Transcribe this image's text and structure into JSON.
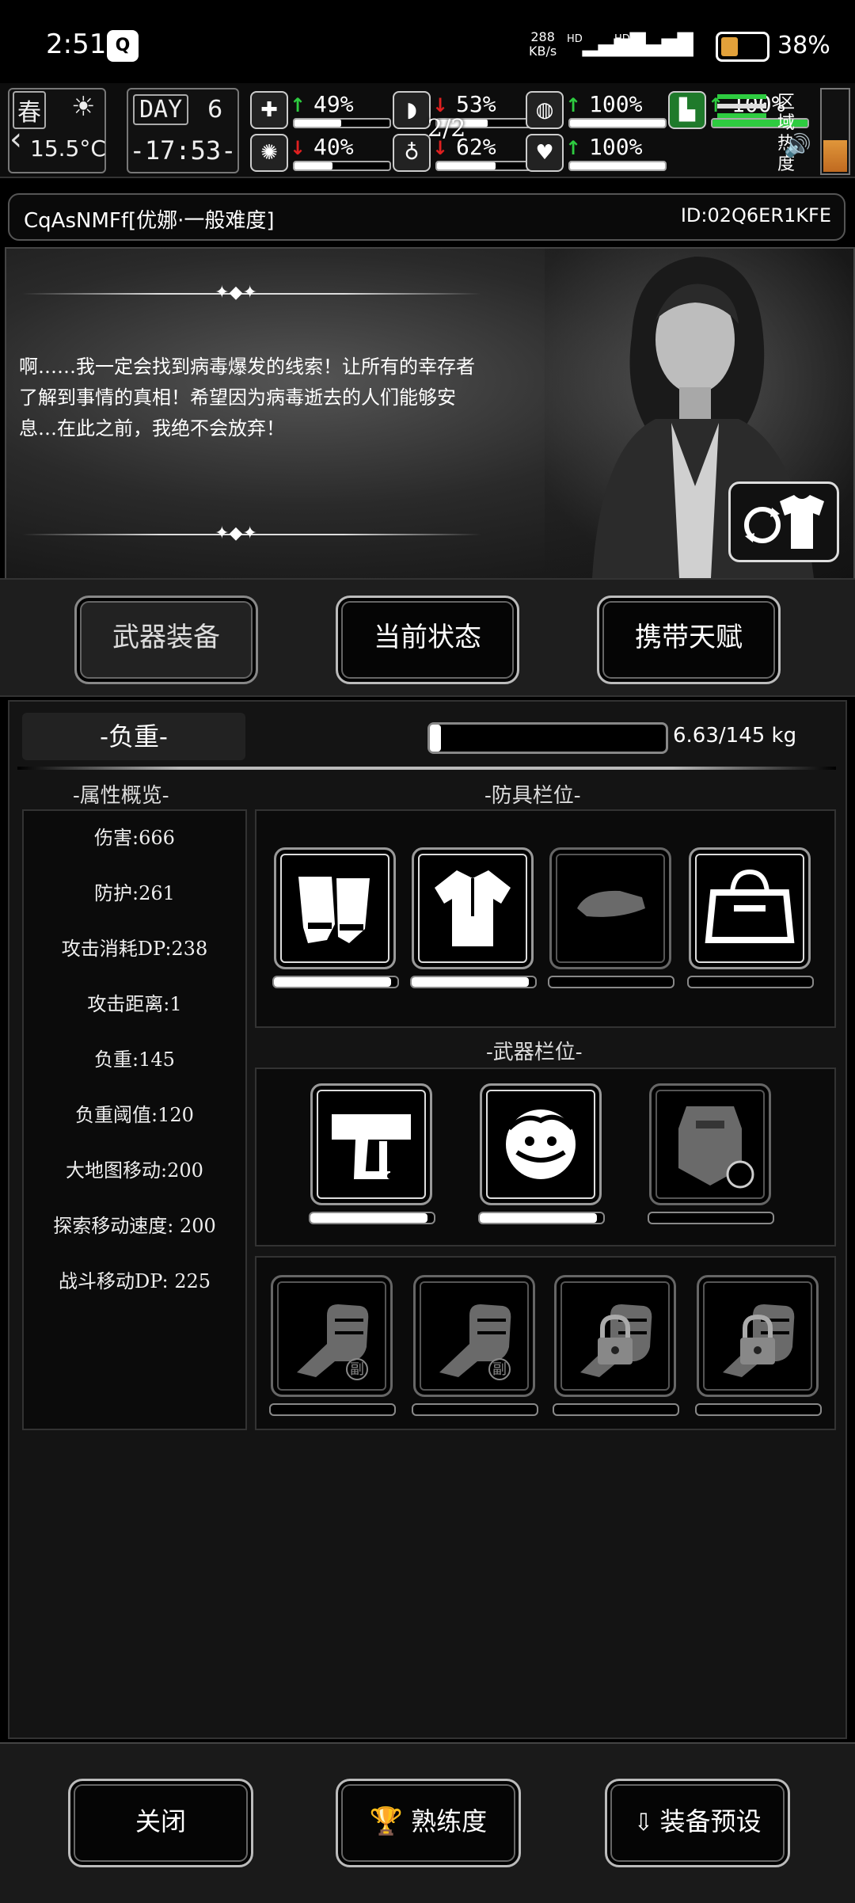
{
  "status_bar": {
    "time": "2:51",
    "app_icon": "qq-icon",
    "net_speed": "288",
    "net_unit": "KB/s",
    "hd1": "HD",
    "hd2": "HD",
    "battery_pct": "38",
    "battery_level": 0.38
  },
  "hud": {
    "season": "春",
    "temperature": "15.5°C",
    "day_label": "DAY",
    "day_num": "6",
    "clock": "-17:53-",
    "page": "2/2",
    "zone_label": "区域热度",
    "stats": [
      {
        "icon": "medkit-icon",
        "arrow": "↑",
        "trend": "up",
        "value": "49%",
        "level": 0.49
      },
      {
        "icon": "brain-icon",
        "arrow": "↓",
        "trend": "down",
        "value": "40%",
        "level": 0.4
      },
      {
        "icon": "stomach-icon",
        "arrow": "↓",
        "trend": "down",
        "value": "53%",
        "level": 0.53
      },
      {
        "icon": "water-icon",
        "arrow": "↓",
        "trend": "down",
        "value": "62%",
        "level": 0.62
      },
      {
        "icon": "lungs-icon",
        "arrow": "↑",
        "trend": "up",
        "value": "100%",
        "level": 1.0
      },
      {
        "icon": "heart-icon",
        "arrow": "↑",
        "trend": "up",
        "value": "100%",
        "level": 1.0
      },
      {
        "icon": "boot-icon",
        "arrow": "↑",
        "trend": "up",
        "value": "100%",
        "level": 1.0
      }
    ]
  },
  "title_bar": {
    "name": "CqAsNMFf[优娜·一般难度]",
    "id": "ID:02Q6ER1KFE"
  },
  "story": {
    "text": "啊……我一定会找到病毒爆发的线索！让所有的幸存者了解到事情的真相！希望因为病毒逝去的人们能够安息…在此之前，我绝不会放弃！"
  },
  "tabs": [
    {
      "label": "武器装备",
      "active": true
    },
    {
      "label": "当前状态",
      "active": false
    },
    {
      "label": "携带天赋",
      "active": false
    }
  ],
  "load": {
    "label": "-负重-",
    "value": "6.63/145 kg",
    "ratio": 0.046
  },
  "attributes": {
    "header": "-属性概览-",
    "items": [
      "伤害:666",
      "防护:261",
      "攻击消耗DP:238",
      "攻击距离:1",
      "负重:145",
      "负重阈值:120",
      "大地图移动:200",
      "探索移动速度: 200",
      "战斗移动DP: 225"
    ]
  },
  "armor": {
    "header": "-防具栏位-",
    "slots": [
      {
        "name": "gloves-icon",
        "durability": 0.95
      },
      {
        "name": "shirt-icon",
        "durability": 0.95
      },
      {
        "name": "cap-icon",
        "durability": 0
      },
      {
        "name": "bag-icon",
        "durability": 0
      }
    ]
  },
  "weapons": {
    "header": "-武器栏位-",
    "slots": [
      {
        "name": "staple-gun-icon",
        "durability": 0.95
      },
      {
        "name": "medusa-icon",
        "durability": 0.95
      },
      {
        "name": "riot-shield-icon",
        "durability": 0
      }
    ],
    "sub_slots": [
      {
        "name": "fist-icon",
        "badge": "副",
        "locked": false
      },
      {
        "name": "fist-icon",
        "badge": "副",
        "locked": false
      },
      {
        "name": "fist-icon",
        "badge": "",
        "locked": true
      },
      {
        "name": "fist-icon",
        "badge": "",
        "locked": true
      }
    ]
  },
  "bottom": {
    "close": "关闭",
    "proficiency": "熟练度",
    "preset": "装备预设"
  }
}
